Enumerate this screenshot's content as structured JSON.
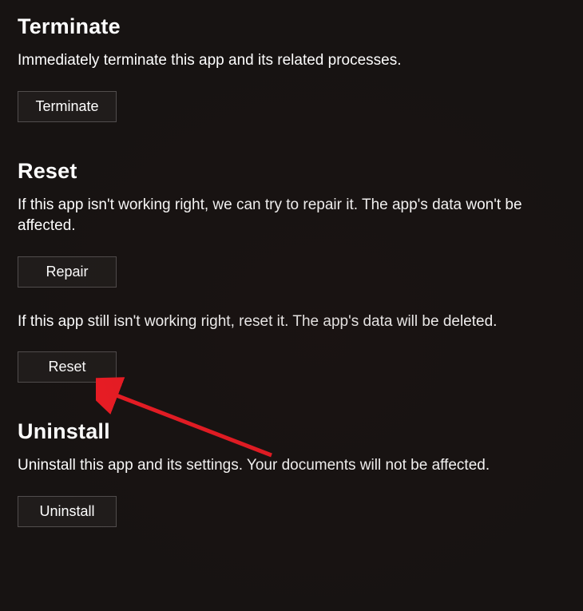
{
  "sections": {
    "terminate": {
      "title": "Terminate",
      "description": "Immediately terminate this app and its related processes.",
      "button_label": "Terminate"
    },
    "reset": {
      "title": "Reset",
      "repair_description": "If this app isn't working right, we can try to repair it. The app's data won't be affected.",
      "repair_button_label": "Repair",
      "reset_description": "If this app still isn't working right, reset it. The app's data will be deleted.",
      "reset_button_label": "Reset"
    },
    "uninstall": {
      "title": "Uninstall",
      "description": "Uninstall this app and its settings. Your documents will not be affected.",
      "button_label": "Uninstall"
    }
  },
  "annotation": {
    "arrow_color": "#ee1c25"
  }
}
